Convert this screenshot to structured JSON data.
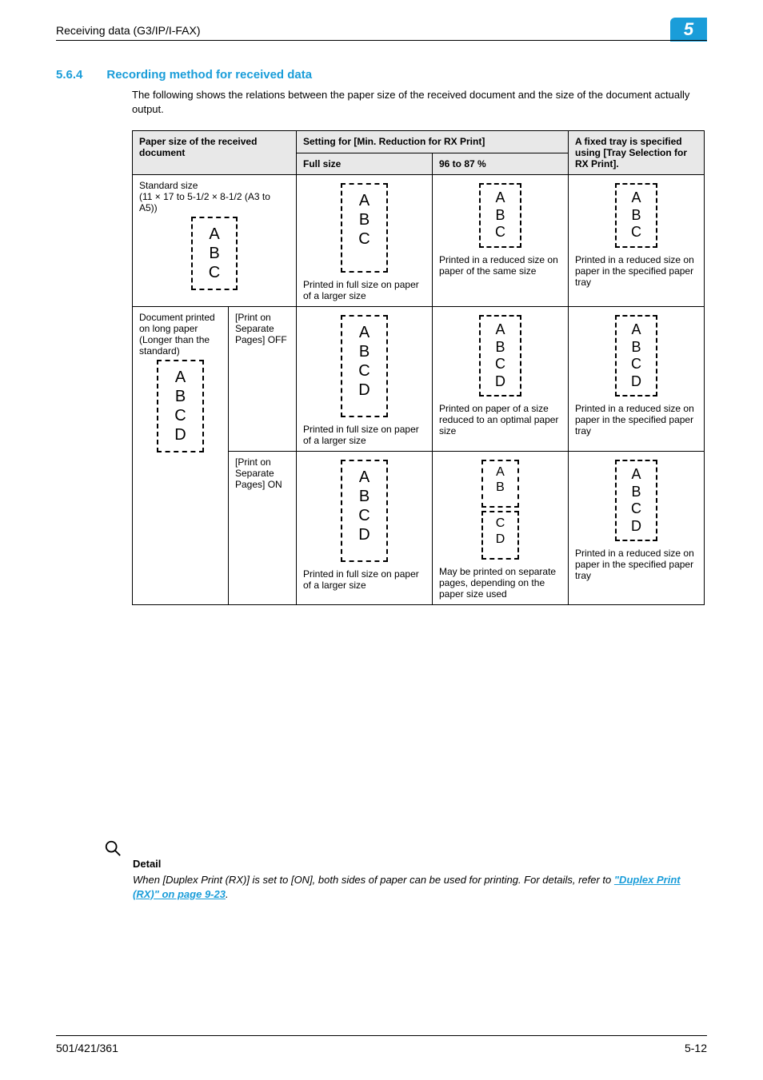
{
  "header": {
    "left": "Receiving data (G3/IP/I-FAX)",
    "badge": "5"
  },
  "section": {
    "number": "5.6.4",
    "title": "Recording method for received data"
  },
  "intro": "The following shows the relations between the paper size of the received document and the size of the document actually output.",
  "table": {
    "head": {
      "paper_size": "Paper size of the received document",
      "setting": "Setting for [Min. Reduction for RX Print]",
      "fixed_tray": "A fixed tray is specified using [Tray Selection for RX Print].",
      "full_size": "Full size",
      "pct": "96 to 87 %"
    },
    "row1": {
      "label_title": "Standard size",
      "label_sub": "(11 × 17 to 5-1/2 × 8-1/2 (A3 to A5))",
      "sample": "A\nB\nC",
      "full_img": "A\nB\nC",
      "full_cap": "Printed in full size on paper of a larger size",
      "pct_img": "A\nB\nC",
      "pct_cap": "Printed in a reduced size on paper of the same size",
      "tray_img": "A\nB\nC",
      "tray_cap": "Printed in a reduced size on paper in the specified paper tray"
    },
    "row2": {
      "label_line1": "Document printed on long paper",
      "label_line2": "(Longer than the standard)",
      "sample": "A\nB\nC\nD",
      "off": "[Print on Separate Pages] OFF",
      "off_full_img": "A\nB\nC\nD",
      "off_full_cap": "Printed in full size on paper of a larger size",
      "off_pct_img": "A\nB\nC\nD",
      "off_pct_cap": "Printed on paper of a size reduced to an optimal paper size",
      "off_tray_img": "A\nB\nC\nD",
      "off_tray_cap": "Printed in a reduced size on paper in the specified paper tray",
      "on": "[Print on Separate Pages] ON",
      "on_full_img": "A\nB\nC\nD",
      "on_full_cap": "Printed in full size on paper of a larger size",
      "on_pct_img_top": "A\nB",
      "on_pct_img_bot": "C\nD",
      "on_pct_cap": "May be printed on separate pages, depending on the paper size used",
      "on_tray_img": "A\nB\nC\nD",
      "on_tray_cap": "Printed in a reduced size on paper in the specified paper tray"
    }
  },
  "detail": {
    "label": "Detail",
    "text_before": "When [Duplex Print (RX)] is set to [ON], both sides of paper can be used for printing. For details, refer to ",
    "link": "\"Duplex Print (RX)\" on page 9-23",
    "text_after": "."
  },
  "footer": {
    "left": "501/421/361",
    "right": "5-12"
  }
}
